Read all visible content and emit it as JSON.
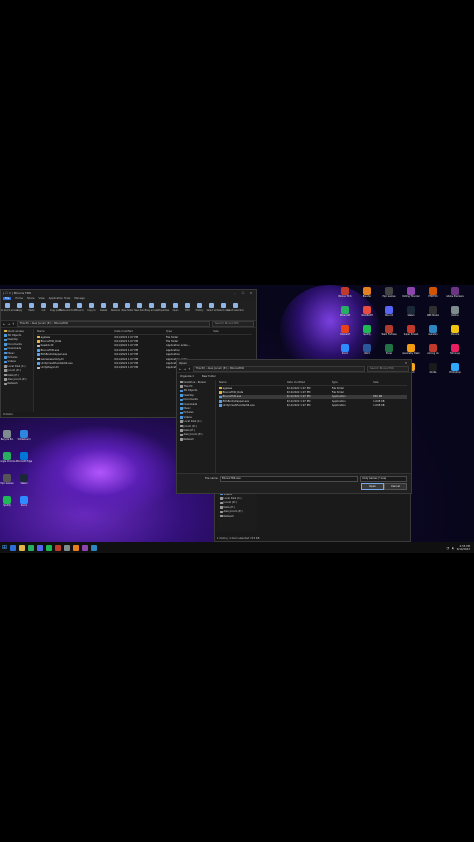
{
  "explorer": {
    "title": "| ☐ = | Bloons TD6",
    "tabs": [
      "File",
      "Home",
      "Share",
      "View",
      "Application Tools",
      "Manage"
    ],
    "ribbon_buttons": [
      "Pin to Quick access",
      "Copy",
      "Paste",
      "Cut",
      "Copy path",
      "Paste shortcut",
      "Move to",
      "Copy to",
      "Delete",
      "Rename",
      "New folder",
      "New item",
      "Easy access",
      "Properties",
      "Open",
      "Edit",
      "History",
      "Select all",
      "Select none",
      "Invert selection"
    ],
    "ribbon_groups": [
      "Clipboard",
      "Organize",
      "New",
      "Open",
      "Select"
    ],
    "path": "This PC  ›  Alex Jocum (E:)  ›  BloonsTD6",
    "search_placeholder": "Search BloonsTD6",
    "nav": [
      "Quick access",
      "3D Objects",
      "Desktop",
      "Documents",
      "Downloads",
      "Music",
      "Pictures",
      "Videos",
      "Local Disk (C:)",
      "Jocum (D:)",
      "Kalia (E:)",
      "Alex Jocum (E:)",
      "Network"
    ],
    "columns": [
      "Name",
      "Date modified",
      "Type",
      "Size"
    ],
    "files": [
      {
        "name": "ageless",
        "date": "6/11/2022 1:07 PM",
        "type": "File folder",
        "size": "",
        "kind": "folder"
      },
      {
        "name": "BloonsTD6_Data",
        "date": "6/11/2022 1:07 PM",
        "type": "File folder",
        "size": "",
        "kind": "folder"
      },
      {
        "name": "baselib.dll",
        "date": "6/11/2022 1:07 PM",
        "type": "Application exten...",
        "size": "",
        "kind": "dll"
      },
      {
        "name": "BloonsTD6.exe",
        "date": "6/11/2022 1:07 PM",
        "type": "Application",
        "size": "",
        "kind": "app"
      },
      {
        "name": "EOSBootstrapper.exe",
        "date": "6/11/2022 1:07 PM",
        "type": "Application",
        "size": "",
        "kind": "app"
      },
      {
        "name": "GameAssembly.dll",
        "date": "6/11/2022 1:07 PM",
        "type": "Application exten...",
        "size": "",
        "kind": "dll"
      },
      {
        "name": "UnityCrashHandler64.exe",
        "date": "6/11/2022 1:07 PM",
        "type": "Application",
        "size": "",
        "kind": "app"
      },
      {
        "name": "UnityPlayer.dll",
        "date": "6/11/2022 1:07 PM",
        "type": "Application exten...",
        "size": "",
        "kind": "dll"
      }
    ],
    "status": "9 items"
  },
  "dialog": {
    "title": "Open",
    "path": "This PC  ›  Alex Jocum (E:)  ›  BloonsTD6",
    "search_placeholder": "Search BloonsTD6",
    "organize": "Organize ▾",
    "new_folder": "New folder",
    "nav": [
      "OneDrive - Person",
      "This PC",
      "3D Objects",
      "Desktop",
      "Documents",
      "Downloads",
      "Music",
      "Pictures",
      "Videos",
      "Local Disk (C:)",
      "Jocum (D:)",
      "Kalia (E:)",
      "Alex Jocum (E:)",
      "Network"
    ],
    "columns": [
      "Name",
      "Date modified",
      "Type",
      "Size"
    ],
    "files": [
      {
        "name": "ageless",
        "date": "6/11/2022 1:07 PM",
        "type": "File folder",
        "size": "",
        "kind": "folder"
      },
      {
        "name": "BloonsTD6_Data",
        "date": "6/11/2022 1:07 PM",
        "type": "File folder",
        "size": "",
        "kind": "folder"
      },
      {
        "name": "BloonsTD6.exe",
        "date": "6/11/2022 1:07 PM",
        "type": "Application",
        "size": "650 KB",
        "kind": "app",
        "selected": true
      },
      {
        "name": "EOSBootstrapper.exe",
        "date": "6/11/2022 1:07 PM",
        "type": "Application",
        "size": "1,098 KB",
        "kind": "app"
      },
      {
        "name": "UnityCrashHandler64.exe",
        "date": "6/11/2022 1:07 PM",
        "type": "Application",
        "size": "1,098 KB",
        "kind": "app"
      }
    ],
    "file_name_label": "File name:",
    "file_name_value": "BloonsTD6.exe",
    "file_type": "Unity Games (*.exe)",
    "open_label": "Open",
    "cancel_label": "Cancel"
  },
  "back_window": {
    "nav": [
      "Videos",
      "Local Disk (C:)",
      "Jocum (D:)",
      "Kalia (E:)",
      "Alex Jocum (E:)",
      "Network"
    ],
    "status": "1 items  |  1 item selected  723 KB"
  },
  "desktop_icons_right": [
    {
      "label": "Bloons TD 6",
      "color": "#c0392b"
    },
    {
      "label": "Blender",
      "color": "#e67e22"
    },
    {
      "label": "Epic Games",
      "color": "#444"
    },
    {
      "label": "Rolling Thunder",
      "color": "#8e44ad"
    },
    {
      "label": "PHOTOS",
      "color": "#d35400"
    },
    {
      "label": "Adobe Premiere",
      "color": "#6c3483"
    },
    {
      "label": "Minecraft",
      "color": "#27ae60"
    },
    {
      "label": "VALORANT",
      "color": "#e74c3c"
    },
    {
      "label": "Discord",
      "color": "#5865f2"
    },
    {
      "label": "Steam",
      "color": "#1b2838"
    },
    {
      "label": "OBS Studio",
      "color": "#302e31"
    },
    {
      "label": "Roblox",
      "color": "#7f8c8d"
    },
    {
      "label": "Overwolf",
      "color": "#e84118"
    },
    {
      "label": "Spotify",
      "color": "#1db954"
    },
    {
      "label": "Team Fortress",
      "color": "#b03a2e"
    },
    {
      "label": "Super Smash",
      "color": "#c0392b"
    },
    {
      "label": "Genshin",
      "color": "#2e86c1"
    },
    {
      "label": "Chrome",
      "color": "#f1c40f"
    },
    {
      "label": "Zoom",
      "color": "#2d8cff"
    },
    {
      "label": "Word",
      "color": "#2b579a"
    },
    {
      "label": "Excel",
      "color": "#217346"
    },
    {
      "label": "Geometry Dash",
      "color": "#f39c12"
    },
    {
      "label": "Among Us",
      "color": "#c0392b"
    },
    {
      "label": "Fall Guys",
      "color": "#e91e63"
    },
    {
      "label": "Brave",
      "color": "#fb542b"
    },
    {
      "label": "Audacity",
      "color": "#0f63b0"
    },
    {
      "label": "Notepad++",
      "color": "#8bc34a"
    },
    {
      "label": "Sketch",
      "color": "#f5a623"
    },
    {
      "label": "Kindle",
      "color": "#1a1a1a"
    },
    {
      "label": "Photoshop",
      "color": "#31a8ff"
    }
  ],
  "desktop_icons_left": [
    {
      "label": "Recycle Bin",
      "color": "#7f8c8d"
    },
    {
      "label": "Whiteboard",
      "color": "#2e86de"
    },
    {
      "label": "Google Chrome",
      "color": "#27ae60"
    },
    {
      "label": "Microsoft Edge",
      "color": "#0078d7"
    },
    {
      "label": "Epic Games",
      "color": "#555"
    },
    {
      "label": "Steam",
      "color": "#1b2838"
    },
    {
      "label": "Spotify",
      "color": "#1db954"
    },
    {
      "label": "Zoom",
      "color": "#2d8cff"
    }
  ],
  "taskbar": {
    "time": "4:55 PM",
    "date": "6/14/2022",
    "apps": [
      "#2b6fd6",
      "#e0b64a",
      "#27ae60",
      "#5865f2",
      "#1db954",
      "#c0392b",
      "#7f8c8d",
      "#e67e22",
      "#8e44ad",
      "#2e86c1"
    ]
  }
}
